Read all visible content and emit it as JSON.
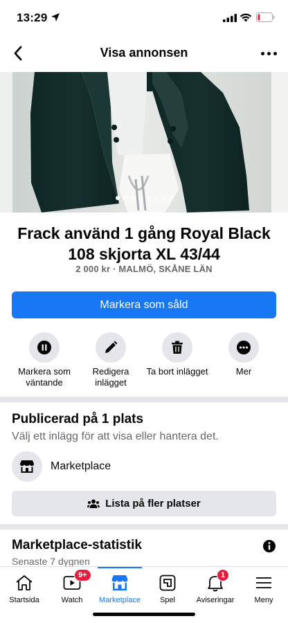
{
  "status": {
    "time": "13:29"
  },
  "header": {
    "title": "Visa annonsen"
  },
  "hero": {
    "image_count": 8,
    "active_index": 0
  },
  "listing": {
    "title": "Frack använd 1 gång Royal Black 108 skjorta XL 43/44",
    "meta": "2 000 kr · MALMÖ, SKÅNE LÄN"
  },
  "primary_button": "Markera som såld",
  "actions": [
    {
      "icon": "pause-icon",
      "label": "Markera som väntande"
    },
    {
      "icon": "pencil-icon",
      "label": "Redigera inlägget"
    },
    {
      "icon": "trash-icon",
      "label": "Ta bort inlägget"
    },
    {
      "icon": "more-icon",
      "label": "Mer"
    }
  ],
  "published": {
    "title": "Publicerad på 1 plats",
    "subtitle": "Välj ett inlägg för att visa eller hantera det.",
    "place": "Marketplace",
    "list_more_button": "Lista på fler platser"
  },
  "stats": {
    "title": "Marketplace-statistik",
    "subtitle": "Senaste 7 dygnen"
  },
  "nav": {
    "items": [
      {
        "label": "Startsida",
        "icon": "home-icon",
        "badge": ""
      },
      {
        "label": "Watch",
        "icon": "watch-icon",
        "badge": "9+"
      },
      {
        "label": "Marketplace",
        "icon": "marketplace-icon",
        "badge": "",
        "active": true
      },
      {
        "label": "Spel",
        "icon": "gaming-icon",
        "badge": ""
      },
      {
        "label": "Aviseringar",
        "icon": "bell-icon",
        "badge": "1"
      },
      {
        "label": "Meny",
        "icon": "menu-icon",
        "badge": ""
      }
    ]
  },
  "colors": {
    "accent": "#1877f2",
    "badge": "#e41e3f",
    "muted": "#65676b",
    "surface": "#e4e6eb"
  }
}
